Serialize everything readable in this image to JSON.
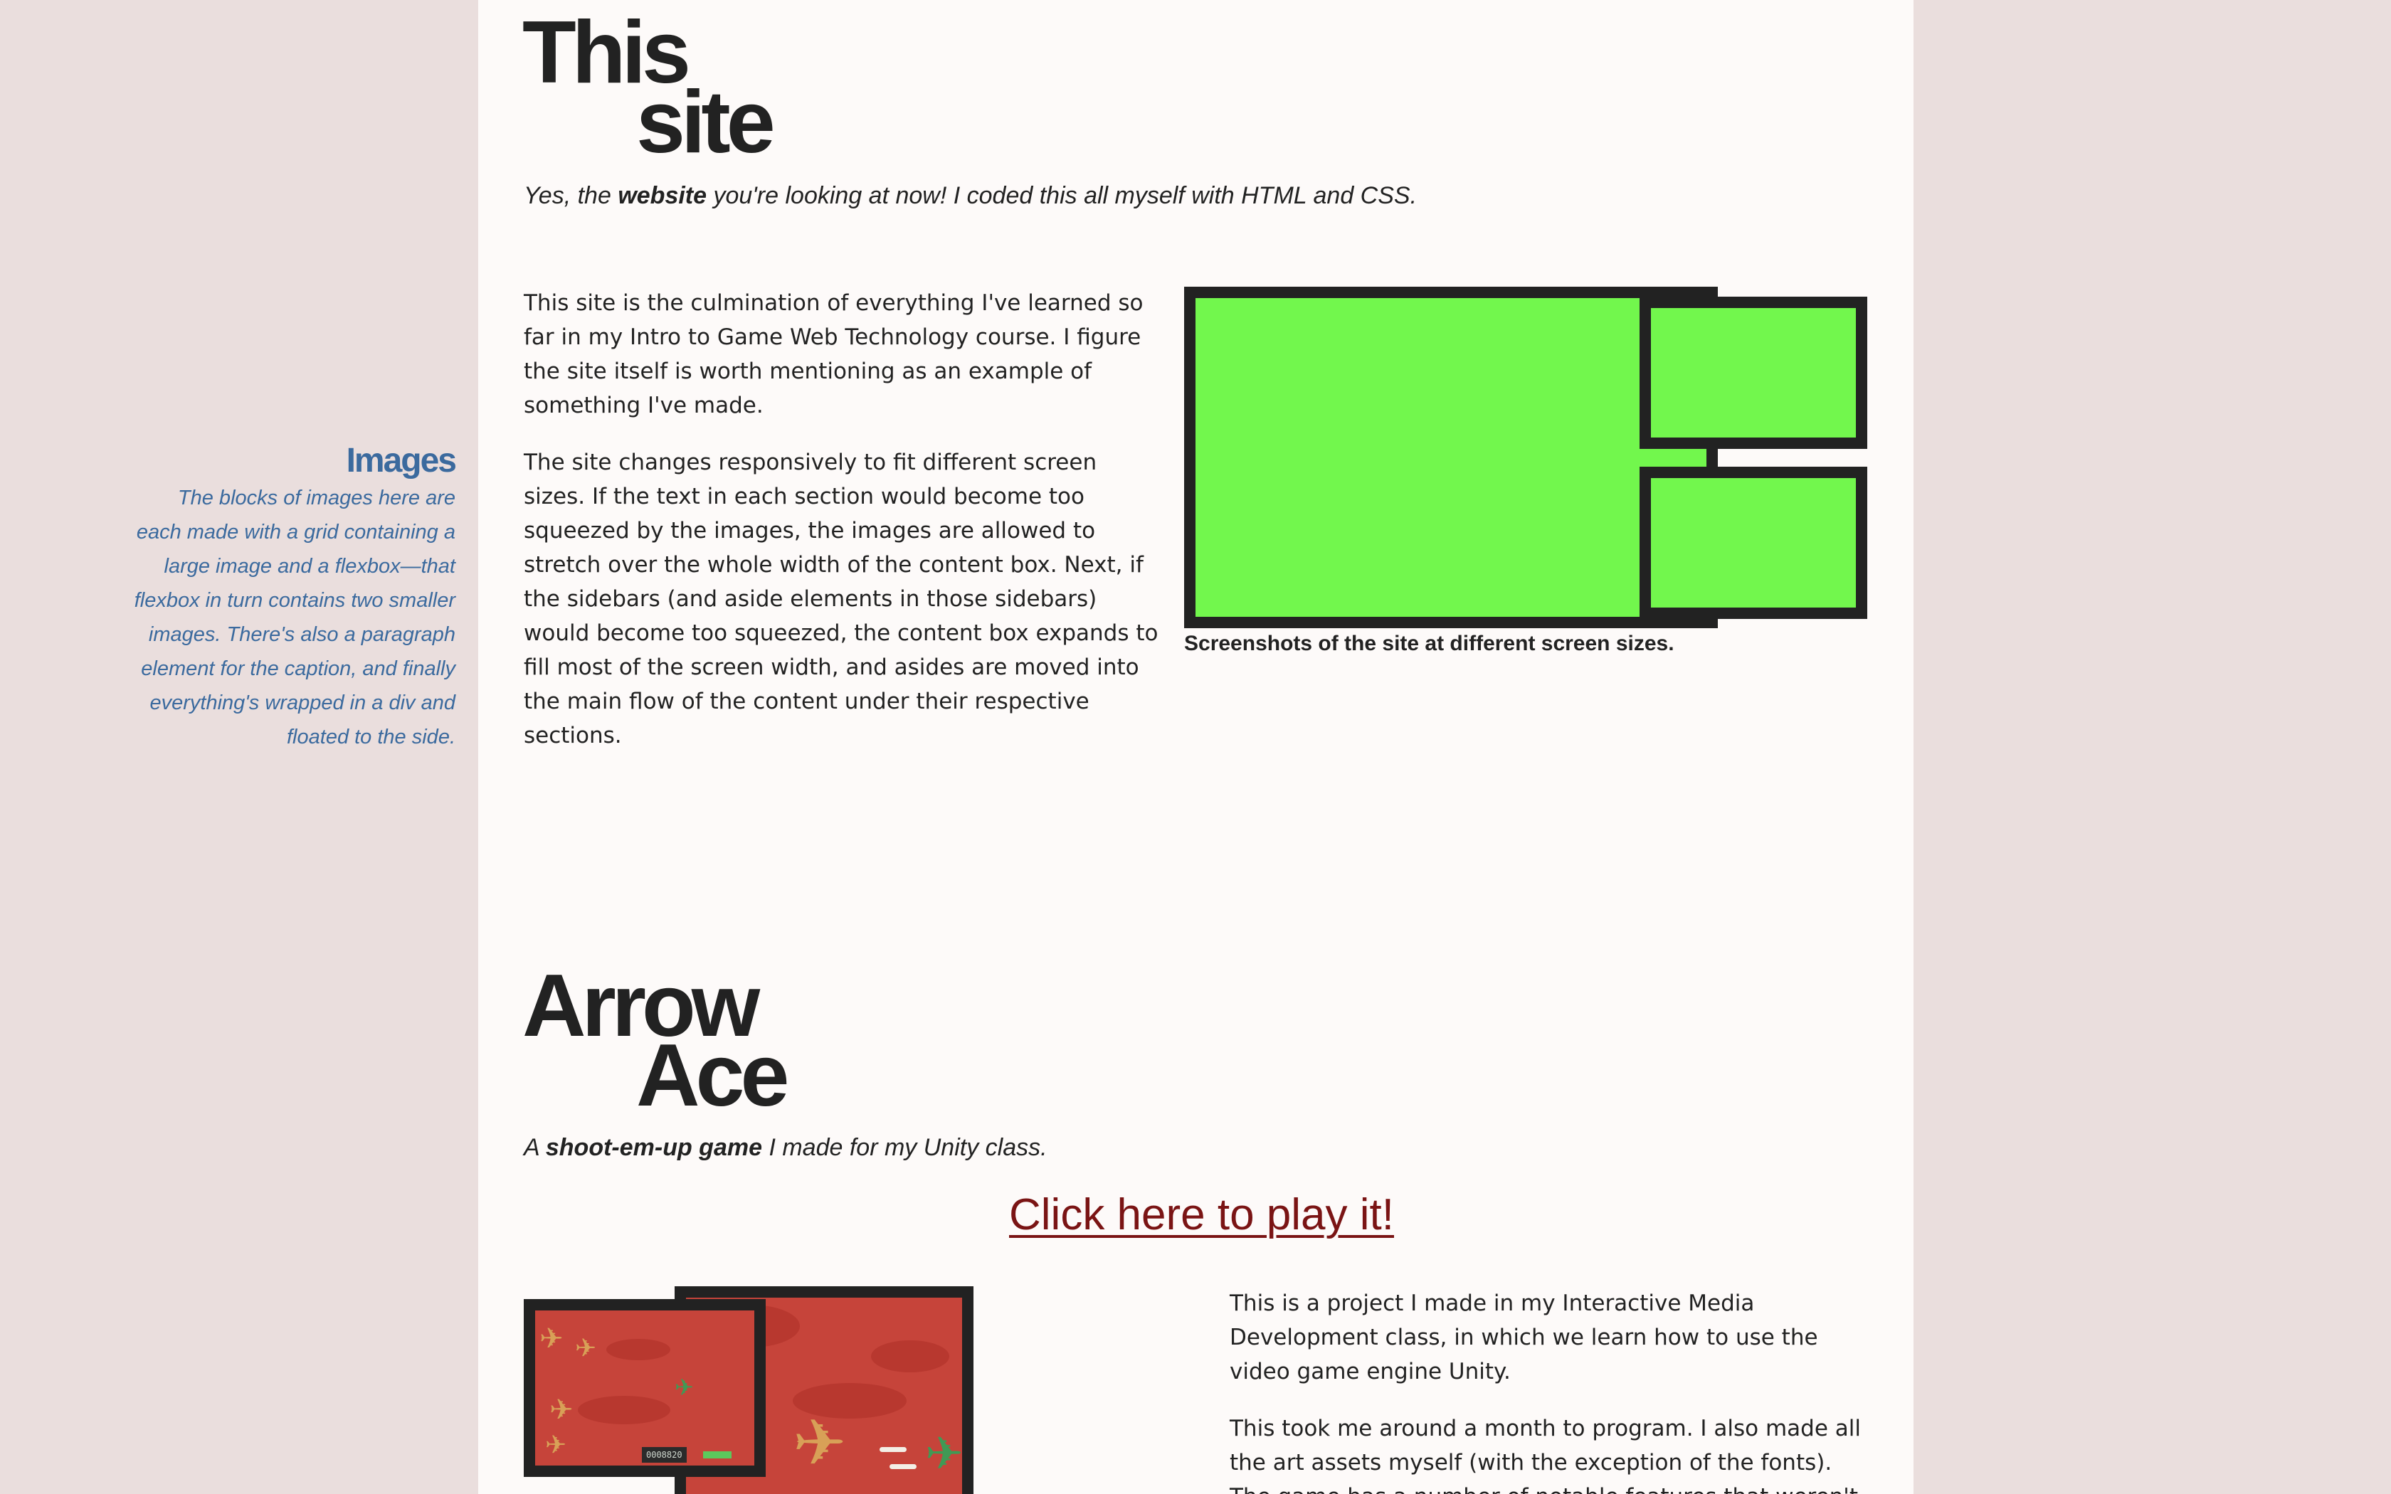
{
  "section_site": {
    "title_line1": "This",
    "title_line2": "site",
    "subtitle_pre": "Yes, the ",
    "subtitle_bold": "website",
    "subtitle_post": " you're looking at now! I coded this all myself with HTML and CSS.",
    "paragraph1": "This site is the culmination of everything I've learned so far in my Intro to Game Web Technology course. I figure the site itself is worth mentioning as an example of something I've made.",
    "paragraph2": "The site changes responsively to fit different screen sizes. If the text in each section would become too squeezed by the images, the images are allowed to stretch over the whole width of the content box. Next, if the sidebars (and aside elements in those sidebars) would become too squeezed, the content box expands to fill most of the screen width, and asides are moved into the main flow of the content under their respective sections.",
    "caption": "Screenshots of the site at different screen sizes.",
    "placeholder_color": "#72f74d"
  },
  "aside_images": {
    "title": "Images",
    "text": "The blocks of images here are each made with a grid containing a large image and a flexbox—that flexbox in turn contains two smaller images. There's also a paragraph element for the caption, and finally everything's wrapped in a div and floated to the side."
  },
  "section_game": {
    "title_line1": "Arrow",
    "title_line2": "Ace",
    "subtitle_pre": "A ",
    "subtitle_bold": "shoot-em-up game",
    "subtitle_post": " I made for my Unity class.",
    "play_link": "Click here to play it!",
    "paragraph1": "This is a project I made in my Interactive Media Development class, in which we learn how to use the video game engine Unity.",
    "paragraph2": "This took me around a month to program. I also made all the art assets myself (with the exception of the fonts). The game has a number of notable features that weren't",
    "hud_score": "0008820"
  },
  "colors": {
    "page_bg": "#eadedd",
    "content_bg": "#fdfaf9",
    "text": "#222222",
    "aside_text": "#3b6a9e",
    "link": "#7a1414",
    "game_red": "#c6443a"
  }
}
